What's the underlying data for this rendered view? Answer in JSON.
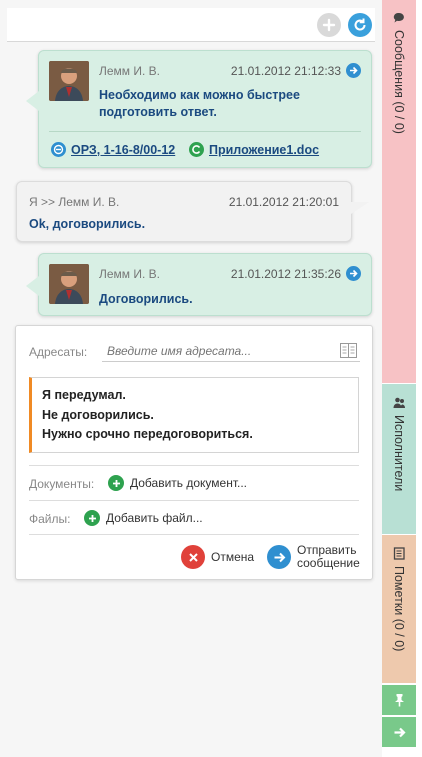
{
  "messages": [
    {
      "author": "Лемм И. В.",
      "date": "21.01.2012 21:12:33",
      "text_lines": [
        "Необходимо как можно быстрее",
        "подготовить ответ."
      ],
      "attachments": [
        "ОРЗ, 1-16-8/00-12",
        "Приложение1.doc"
      ]
    },
    {
      "author": "Я >> Лемм И. В.",
      "date": "21.01.2012 21:20:01",
      "text_lines": [
        "Ok, договорились."
      ]
    },
    {
      "author": "Лемм И. В.",
      "date": "21.01.2012 21:35:26",
      "text_lines": [
        "Договорились."
      ]
    }
  ],
  "compose": {
    "recipients_label": "Адресаты:",
    "recipients_placeholder": "Введите имя адресата...",
    "text_lines": [
      "Я передумал.",
      "Не договорились.",
      "Нужно срочно передоговориться."
    ],
    "documents_label": "Документы:",
    "add_document": "Добавить документ...",
    "files_label": "Файлы:",
    "add_file": "Добавить файл...",
    "cancel": "Отмена",
    "send_line1": "Отправить",
    "send_line2": "сообщение"
  },
  "tabs": {
    "messages": "Сообщения (0 / 0)",
    "executors": "Исполнители",
    "notes": "Пометки (0 / 0)"
  },
  "colors": {
    "incoming_bg": "#d8efe4",
    "outgoing_bg": "#f2f2f2",
    "tab_messages": "#f7c2c5",
    "tab_executors": "#b8e0d4",
    "tab_notes": "#eec9ad",
    "accent_orange": "#f08a24",
    "link_blue": "#1b4a80"
  }
}
